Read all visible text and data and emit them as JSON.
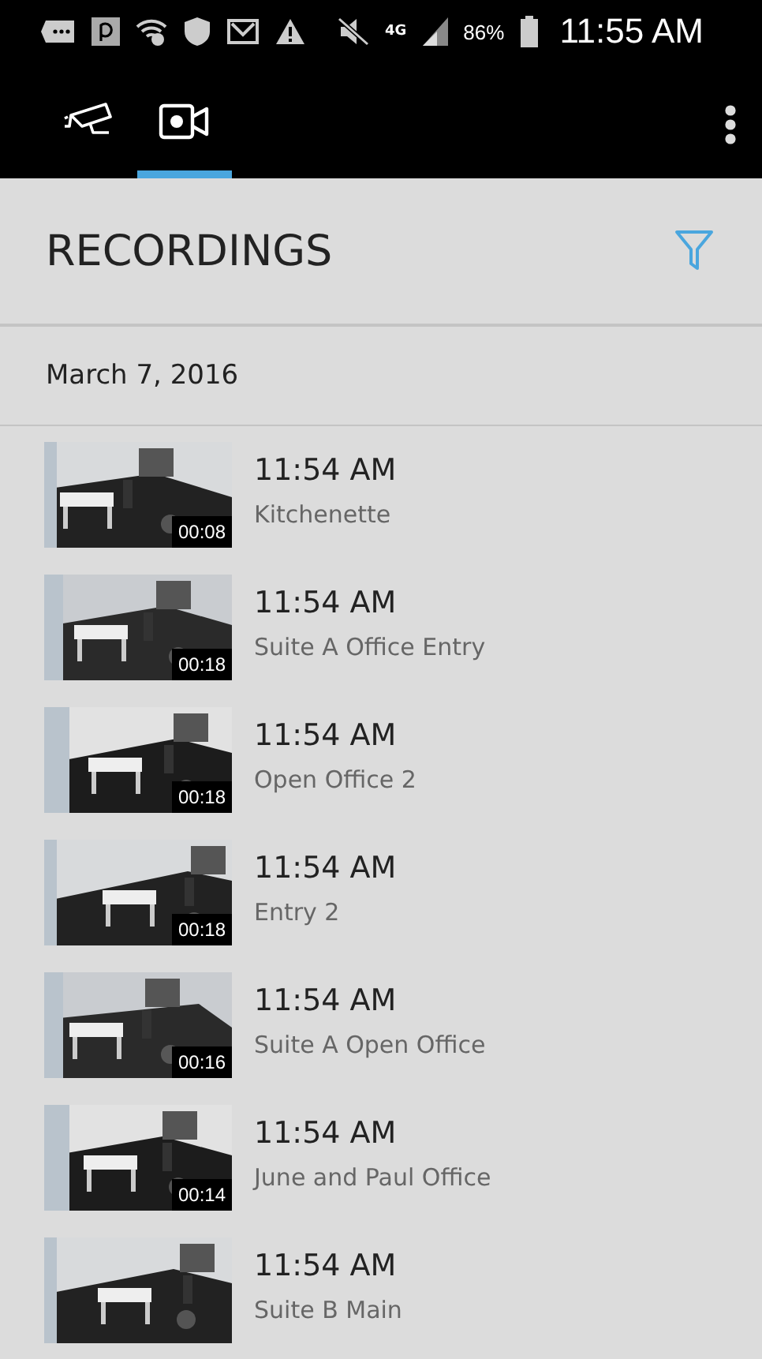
{
  "status_bar": {
    "network": "4G",
    "battery": "86%",
    "time": "11:55 AM"
  },
  "tabs": [
    {
      "kind": "cctv",
      "selected": false
    },
    {
      "kind": "video",
      "selected": true
    }
  ],
  "header": {
    "title": "RECORDINGS"
  },
  "date": "March 7, 2016",
  "recordings": [
    {
      "time": "11:54 AM",
      "name": "Kitchenette",
      "duration": "00:08"
    },
    {
      "time": "11:54 AM",
      "name": "Suite A Office Entry",
      "duration": "00:18"
    },
    {
      "time": "11:54 AM",
      "name": "Open Office 2",
      "duration": "00:18"
    },
    {
      "time": "11:54 AM",
      "name": "Entry 2",
      "duration": "00:18"
    },
    {
      "time": "11:54 AM",
      "name": "Suite A Open Office",
      "duration": "00:16"
    },
    {
      "time": "11:54 AM",
      "name": "June and Paul Office",
      "duration": "00:14"
    },
    {
      "time": "11:54 AM",
      "name": "Suite B Main"
    }
  ]
}
